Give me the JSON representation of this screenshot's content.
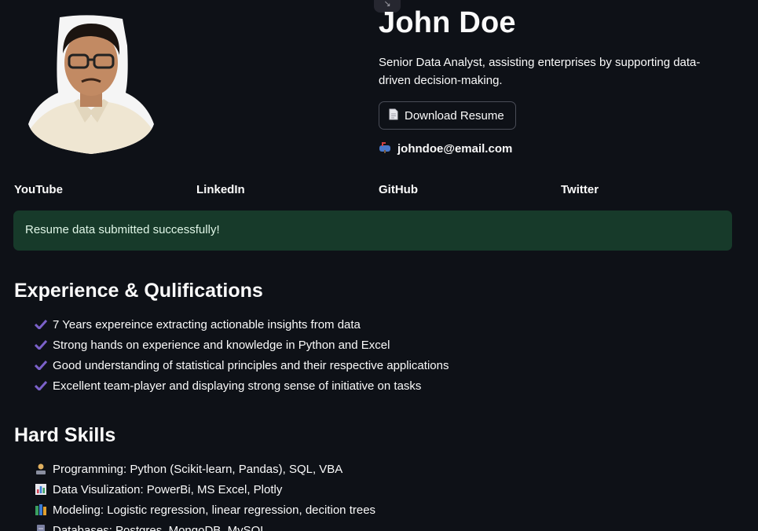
{
  "profile": {
    "name": "John Doe",
    "description": "Senior Data Analyst, assisting enterprises by supporting data-driven decision-making.",
    "download_label": "Download Resume",
    "email": "johndoe@email.com",
    "email_icon": "mailbox-icon",
    "photo_icon": "profile-photo"
  },
  "socials": [
    {
      "label": "YouTube"
    },
    {
      "label": "LinkedIn"
    },
    {
      "label": "GitHub"
    },
    {
      "label": "Twitter"
    }
  ],
  "alert": {
    "message": "Resume data submitted successfully!",
    "color": "#173a2a"
  },
  "experience": {
    "title": "Experience & Qulifications",
    "items": [
      "7 Years expereince extracting actionable insights from data",
      "Strong hands on experience and knowledge in Python and Excel",
      "Good understanding of statistical principles and their respective applications",
      "Excellent team-player and displaying strong sense of initiative on tasks"
    ],
    "check_color": "#7b61c9"
  },
  "skills": {
    "title": "Hard Skills",
    "items": [
      {
        "icon": "technologist-icon",
        "text": "Programming: Python (Scikit-learn, Pandas), SQL, VBA"
      },
      {
        "icon": "bar-chart-icon",
        "text": "Data Visulization: PowerBi, MS Excel, Plotly"
      },
      {
        "icon": "books-icon",
        "text": "Modeling: Logistic regression, linear regression, decition trees"
      },
      {
        "icon": "file-cabinet-icon",
        "text": "Databases: Postgres, MongoDB, MySQL"
      }
    ]
  },
  "theme": {
    "background": "#0e1117",
    "text": "#fafafa"
  }
}
